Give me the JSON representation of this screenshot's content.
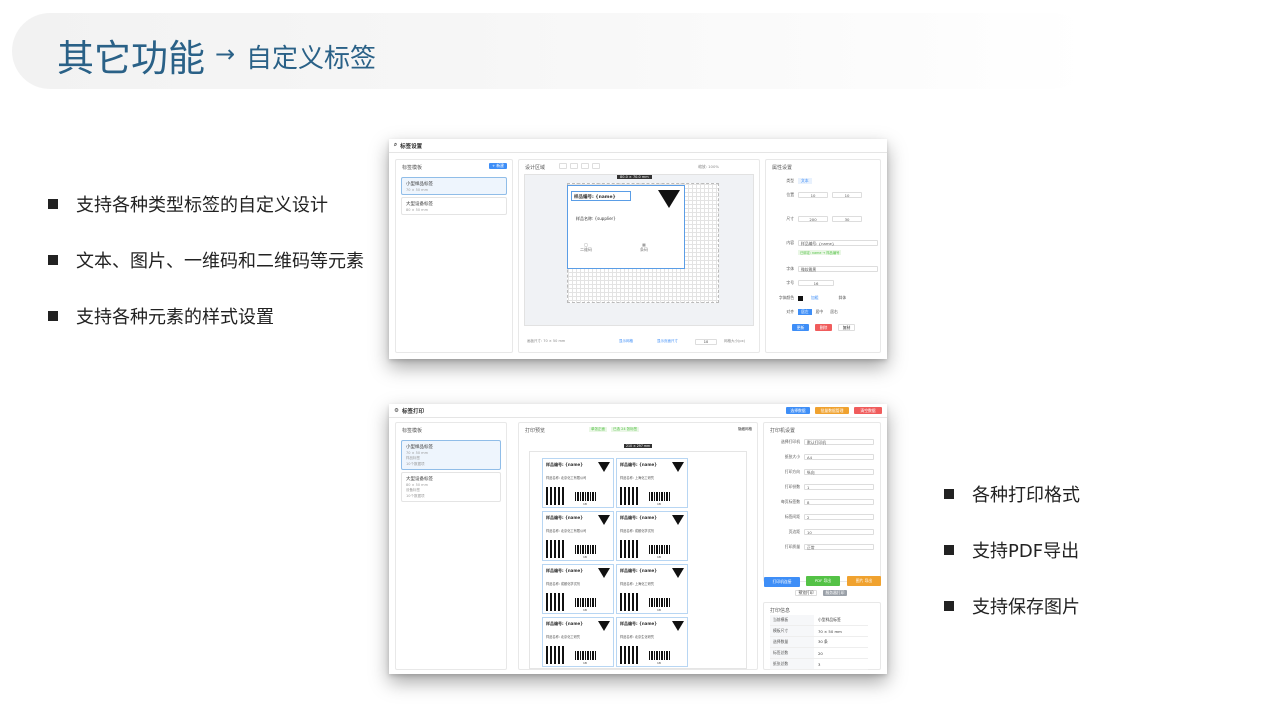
{
  "header": {
    "title": "其它功能",
    "arrow": "→",
    "subtitle": "自定义标签"
  },
  "left_bullets": [
    "支持各种类型标签的自定义设计",
    "文本、图片、一维码和二维码等元素",
    "支持各种元素的样式设置"
  ],
  "right_bullets": [
    "各种打印格式",
    "支持PDF导出",
    "支持保存图片"
  ],
  "shot1": {
    "window_title": "标签设置",
    "templates_title": "标签模板",
    "new_button": "+ 新建",
    "templates": [
      {
        "name": "小型样品标签",
        "size": "70 × 50 mm"
      },
      {
        "name": "大型设备标签",
        "size": "80 × 50 mm"
      }
    ],
    "design_area_title": "设计区域",
    "zoom_text": "缩放: 100%",
    "size_tag": "80.0 × 70.0 mm",
    "label_field1": "样品编号: {name}",
    "label_field2": "样品名称: {supplier}",
    "qr_caption": "二维码",
    "barcode_caption": "条码",
    "footer_size": "画板尺寸: 70 × 50 mm",
    "footer_grid": "显示网格",
    "footer_snap": "显示页面尺寸",
    "footer_grid_value": "10",
    "footer_grid_label": "网格大小(px)",
    "props_title": "属性设置",
    "props": {
      "type_label": "类型",
      "type_value": "文本",
      "pos_label": "位置",
      "pos_x": "10",
      "pos_y": "10",
      "size_label": "尺寸",
      "size_w": "200",
      "size_h": "30",
      "content_label": "内容",
      "content_value": "样品编号: {name}",
      "content_hint": "已绑定: name → 样品编号",
      "font_label": "字体",
      "font_value": "微软雅黑",
      "fontsize_label": "字号",
      "fontsize_value": "16",
      "color_label": "字体颜色",
      "bold_label": "加粗",
      "italic_label": "斜体",
      "align_label": "对齐",
      "align_left": "居左",
      "align_center": "居中",
      "align_right": "居右",
      "btn_update": "更新",
      "btn_delete": "删除",
      "btn_copy": "复制"
    }
  },
  "shot2": {
    "window_title": "标签打印",
    "top_buttons": [
      "选择数据",
      "批量数据管理",
      "清空数据"
    ],
    "templates_title": "标签模板",
    "templates": [
      {
        "name": "小型样品标签",
        "size": "70 × 50 mm",
        "note": "样品标签",
        "tag": "10个数据项"
      },
      {
        "name": "大型设备标签",
        "size": "80 × 50 mm",
        "note": "设备标签",
        "tag": "10个数据项"
      }
    ],
    "preview_title": "打印预览",
    "preview_badge1": "单张正面",
    "preview_badge2": "已选 24 张标签",
    "preview_hide": "隐藏网格",
    "paper_size": "210 × 297 mm",
    "label_title": "样品编号: {name}",
    "label_rows": [
      [
        "样品名称: 北京化工有限公司",
        "样品名称: 上海化工研究"
      ],
      [
        "样品名称: 北京化工有限公司",
        "样品名称: 成都化学试剂"
      ],
      [
        "样品名称: 成都化学试剂",
        "样品名称: 上海化工研究"
      ],
      [
        "样品名称: 北京化工研究",
        "样品名称: 北京生化研究"
      ]
    ],
    "barcode_num": "18",
    "settings_title": "打印机设置",
    "settings": [
      {
        "k": "选择打印机",
        "v": "默认打印机"
      },
      {
        "k": "纸张大小",
        "v": "A4"
      },
      {
        "k": "打印方向",
        "v": "纵向"
      },
      {
        "k": "打印份数",
        "v": "1"
      },
      {
        "k": "每页标签数",
        "v": "8"
      },
      {
        "k": "标签间距",
        "v": "2"
      },
      {
        "k": "页边距",
        "v": "10"
      },
      {
        "k": "打印质量",
        "v": "正常"
      }
    ],
    "action_buttons": [
      "打印机连接",
      "PDF 导出",
      "图片 导出"
    ],
    "small_buttons": [
      "预览打印",
      "服务器打印"
    ],
    "info_title": "打印信息",
    "info": [
      {
        "k": "当前模板",
        "v": "小型样品标签"
      },
      {
        "k": "模板尺寸",
        "v": "70 × 50 mm"
      },
      {
        "k": "选择数量",
        "v": "30 条"
      },
      {
        "k": "标签总数",
        "v": "20"
      },
      {
        "k": "纸张总数",
        "v": "3"
      }
    ]
  },
  "colors": {
    "title": "#2a6187",
    "accent_blue": "#3e8ef7",
    "green": "#54c246",
    "orange": "#f0a22f",
    "red": "#f05c5c"
  }
}
